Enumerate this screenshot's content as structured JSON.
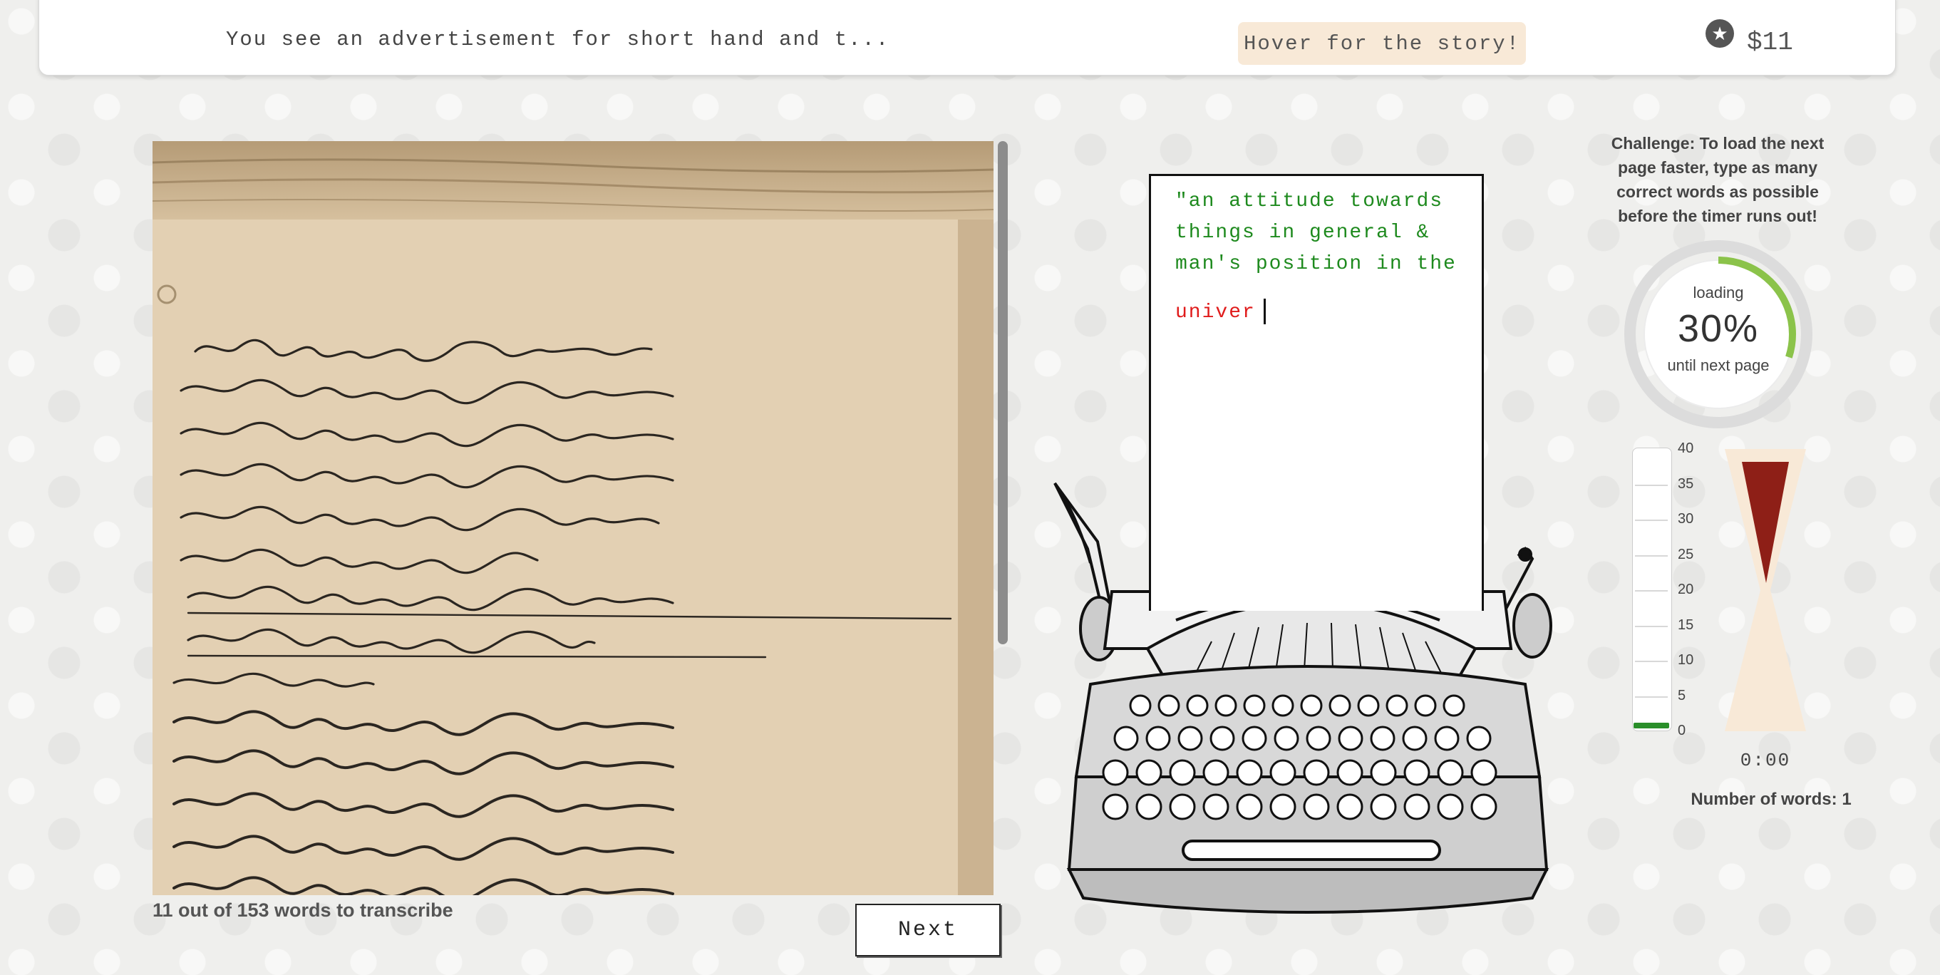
{
  "header": {
    "story_snippet": "You see an advertisement for short hand and t...",
    "hover_button_label": "Hover for the story!",
    "star_icon": "star-icon",
    "money": "$11"
  },
  "transcription": {
    "progress_label": "11 out of 153 words to transcribe",
    "next_button_label": "Next"
  },
  "typewriter": {
    "typed_lines": [
      "\"an attitude towards",
      "things in general &",
      "man's position in the"
    ],
    "current_word": "univer",
    "typed_color": "#1e8a1e",
    "current_color": "#e01b1b"
  },
  "challenge": {
    "text": "Challenge: To load the next page faster, type as many correct words as possible before the timer runs out!",
    "loading_label": "loading",
    "loading_percent": "30%",
    "loading_fraction": 0.3,
    "until_label": "until next page",
    "scale_labels": [
      "40",
      "35",
      "30",
      "25",
      "20",
      "15",
      "10",
      "5",
      "0"
    ],
    "timer": "0:00",
    "word_count_label": "Number of words: 1"
  },
  "colors": {
    "accent_green": "#8bc34a",
    "sand": "#f8e9d7",
    "hourglass_red": "#8e1f17"
  }
}
